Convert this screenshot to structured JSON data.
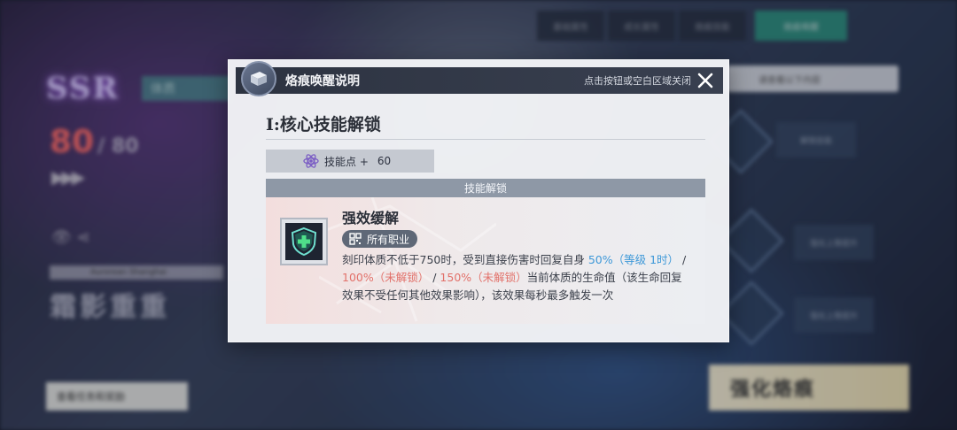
{
  "background": {
    "top_tabs": [
      "基础属性",
      "成长属性",
      "烙痕技能",
      "烙痕唤醒"
    ],
    "rank": "SSR",
    "class_label": "体质",
    "level_current": "80",
    "level_max": "80",
    "name_label": "Aurorean Shanghai",
    "name": "霜影重重",
    "quest_button": "查看任务和奖励",
    "search_placeholder": "请查看以下内容",
    "node_labels": [
      "解锁技能",
      "强化上限提升",
      "强化上限提升"
    ],
    "strengthen_button": "强化烙痕"
  },
  "modal": {
    "title": "烙痕唤醒说明",
    "close_hint": "点击按钮或空白区域关闭",
    "section_title": "I:核心技能解锁",
    "skill_points_label": "技能点 +",
    "skill_points_value": "60",
    "unlock_header": "技能解锁",
    "skill": {
      "name": "强效缓解",
      "tag": "所有职业",
      "desc_part1": "刻印体质不低于750时，受到直接伤害时回复自身 ",
      "desc_level1": "50%（等级 1时）",
      "desc_sep1": " / ",
      "desc_level2": "100%（未解锁）",
      "desc_sep2": " / ",
      "desc_level3": "150%（未解锁）",
      "desc_part2": "当前体质的生命值（该生命回复效果不受任何其他效果影响），该效果每秒最多触发一次"
    }
  },
  "colors": {
    "accent_blue": "#3d98d8",
    "locked_red": "#e2716a",
    "header_dark": "#2d3341",
    "teal_tab": "#2f8f80"
  },
  "icons": [
    "book-icon",
    "close-icon",
    "atom-icon",
    "shield-plus-icon",
    "class-grid-icon"
  ]
}
